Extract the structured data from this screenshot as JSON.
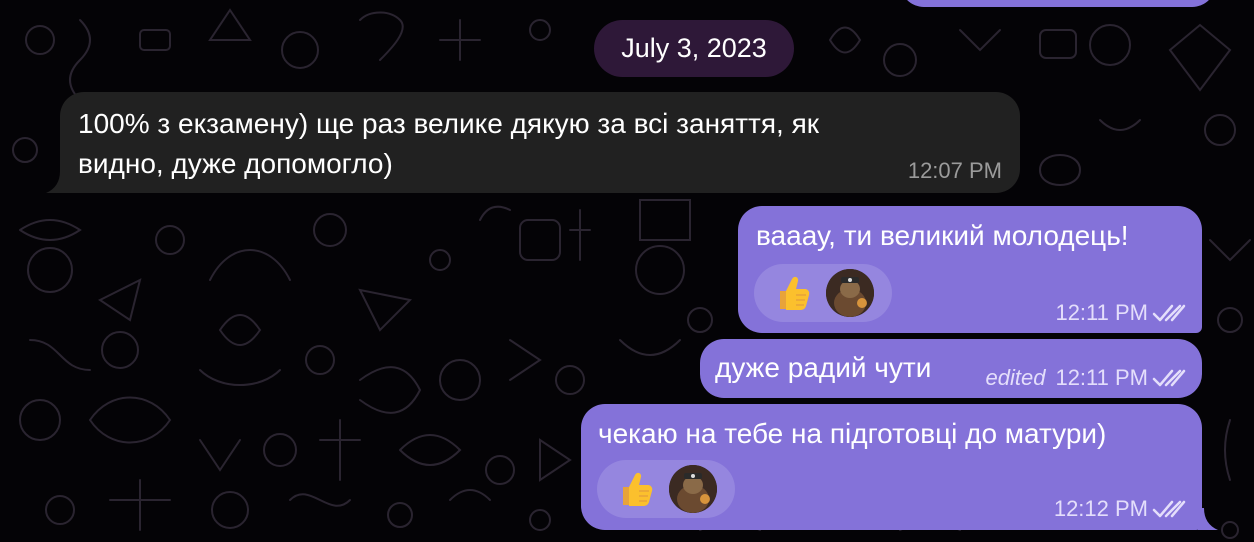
{
  "date_separator": "July 3, 2023",
  "colors": {
    "background": "#040306",
    "incoming_bubble": "#212121",
    "outgoing_bubble": "#8472d9",
    "date_pill": "#2e1838",
    "reaction_pill": "#9586df"
  },
  "messages": [
    {
      "direction": "incoming",
      "lines": [
        "100% з екзамену) ще раз велике дякую за всі заняття, як",
        "видно, дуже допомогло)"
      ],
      "time": "12:07 PM"
    },
    {
      "direction": "outgoing",
      "text": "вааау, ти великий молодець!",
      "time": "12:11 PM",
      "read_status": "double-check-icon",
      "reactions": [
        "thumbs-up-emoji",
        "user-avatar"
      ]
    },
    {
      "direction": "outgoing",
      "text": "дуже радий чути",
      "edited_label": "edited",
      "time": "12:11 PM",
      "read_status": "double-check-icon"
    },
    {
      "direction": "outgoing",
      "text": "чекаю на тебе на підготовці до матури)",
      "time": "12:12 PM",
      "read_status": "double-check-icon",
      "reactions": [
        "thumbs-up-emoji",
        "user-avatar"
      ]
    }
  ]
}
